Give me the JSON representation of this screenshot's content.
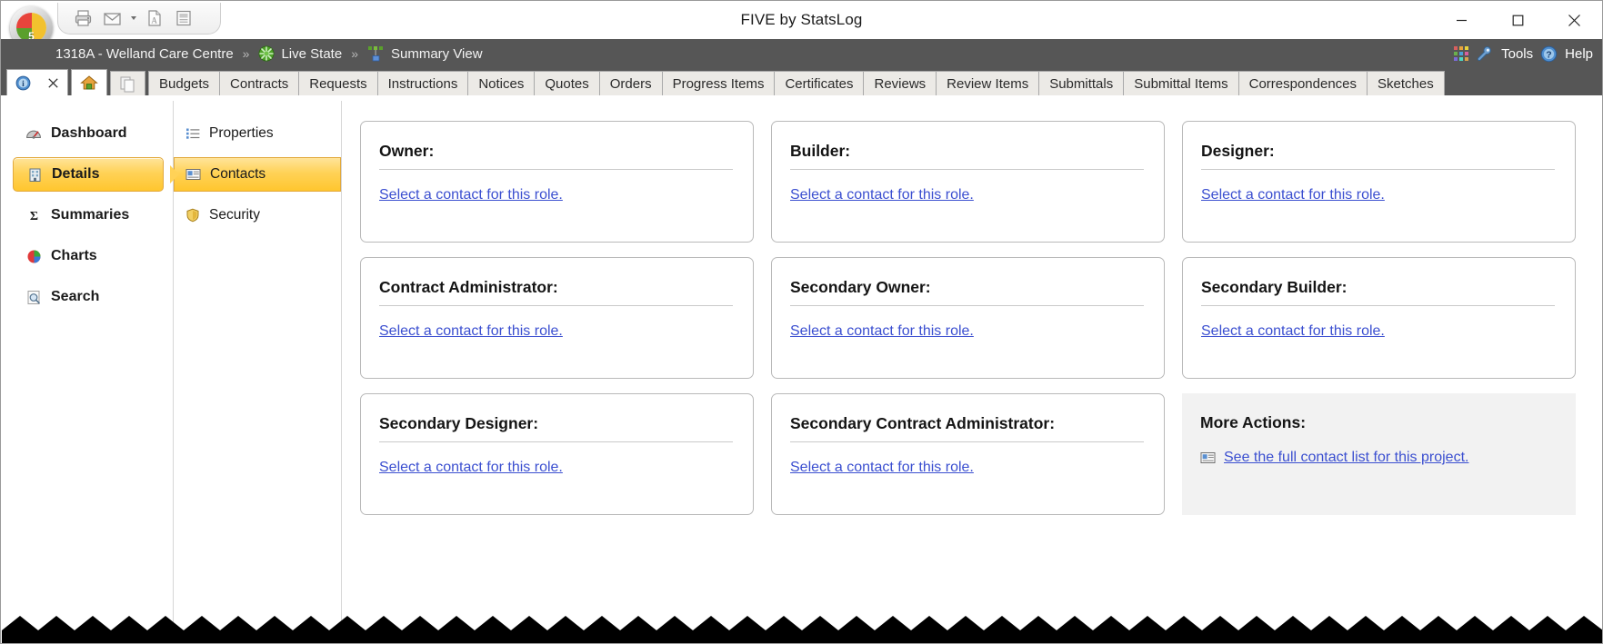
{
  "window": {
    "title": "FIVE by StatsLog",
    "minimize_label": "Minimize",
    "maximize_label": "Maximize",
    "close_label": "Close"
  },
  "quick_access": {
    "buttons": [
      {
        "name": "print-icon",
        "label": "Print"
      },
      {
        "name": "email-icon",
        "label": "Email"
      },
      {
        "name": "email-dropdown-caret",
        "label": "Email options"
      },
      {
        "name": "pdf-icon",
        "label": "Export to PDF"
      },
      {
        "name": "report-icon",
        "label": "Report"
      }
    ]
  },
  "breadcrumb": {
    "items": [
      {
        "label": "1318A - Welland Care Centre",
        "icon": ""
      },
      {
        "label": "Live State",
        "icon": "live-state-icon"
      },
      {
        "label": "Summary View",
        "icon": "summary-view-icon"
      }
    ],
    "separator": "»"
  },
  "header_actions": {
    "apps_label": "Apps",
    "tools_label": "Tools",
    "help_label": "Help"
  },
  "tabs": {
    "icon_tabs": [
      {
        "name": "info-tab",
        "glyph": "info-icon"
      },
      {
        "name": "close-tab",
        "glyph": "close-icon"
      },
      {
        "name": "home-tab",
        "glyph": "home-icon"
      },
      {
        "name": "pages-tab",
        "glyph": "pages-icon"
      }
    ],
    "items": [
      "Budgets",
      "Contracts",
      "Requests",
      "Instructions",
      "Notices",
      "Quotes",
      "Orders",
      "Progress Items",
      "Certificates",
      "Reviews",
      "Review Items",
      "Submittals",
      "Submittal Items",
      "Correspondences",
      "Sketches"
    ],
    "active_index": 2
  },
  "sidebar": {
    "items": [
      {
        "label": "Dashboard",
        "icon": "dashboard-gauge-icon",
        "selected": false
      },
      {
        "label": "Details",
        "icon": "details-building-icon",
        "selected": true
      },
      {
        "label": "Summaries",
        "icon": "sigma-icon",
        "selected": false
      },
      {
        "label": "Charts",
        "icon": "pie-chart-icon",
        "selected": false
      },
      {
        "label": "Search",
        "icon": "search-icon",
        "selected": false
      }
    ]
  },
  "subnav": {
    "items": [
      {
        "label": "Properties",
        "icon": "list-icon",
        "selected": false
      },
      {
        "label": "Contacts",
        "icon": "contact-card-icon",
        "selected": true
      },
      {
        "label": "Security",
        "icon": "shield-icon",
        "selected": false
      }
    ]
  },
  "content": {
    "select_link_label": "Select a contact for this role.",
    "cards": [
      {
        "title": "Owner:",
        "link": "Select a contact for this role."
      },
      {
        "title": "Builder:",
        "link": "Select a contact for this role."
      },
      {
        "title": "Designer:",
        "link": "Select a contact for this role."
      },
      {
        "title": "Contract Administrator:",
        "link": "Select a contact for this role."
      },
      {
        "title": "Secondary Owner:",
        "link": "Select a contact for this role."
      },
      {
        "title": "Secondary Builder:",
        "link": "Select a contact for this role."
      },
      {
        "title": "Secondary Designer:",
        "link": "Select a contact for this role."
      },
      {
        "title": "Secondary Contract Administrator:",
        "link": "Select a contact for this role."
      }
    ],
    "more_actions": {
      "title": "More Actions:",
      "link": "See the full contact list for this project."
    }
  },
  "colors": {
    "chrome_dark": "#565656",
    "accent_gold": "#ffd257",
    "accent_gold_border": "#e2a93c",
    "link_blue": "#3b4fd0",
    "panel_gray": "#f2f2f2"
  }
}
